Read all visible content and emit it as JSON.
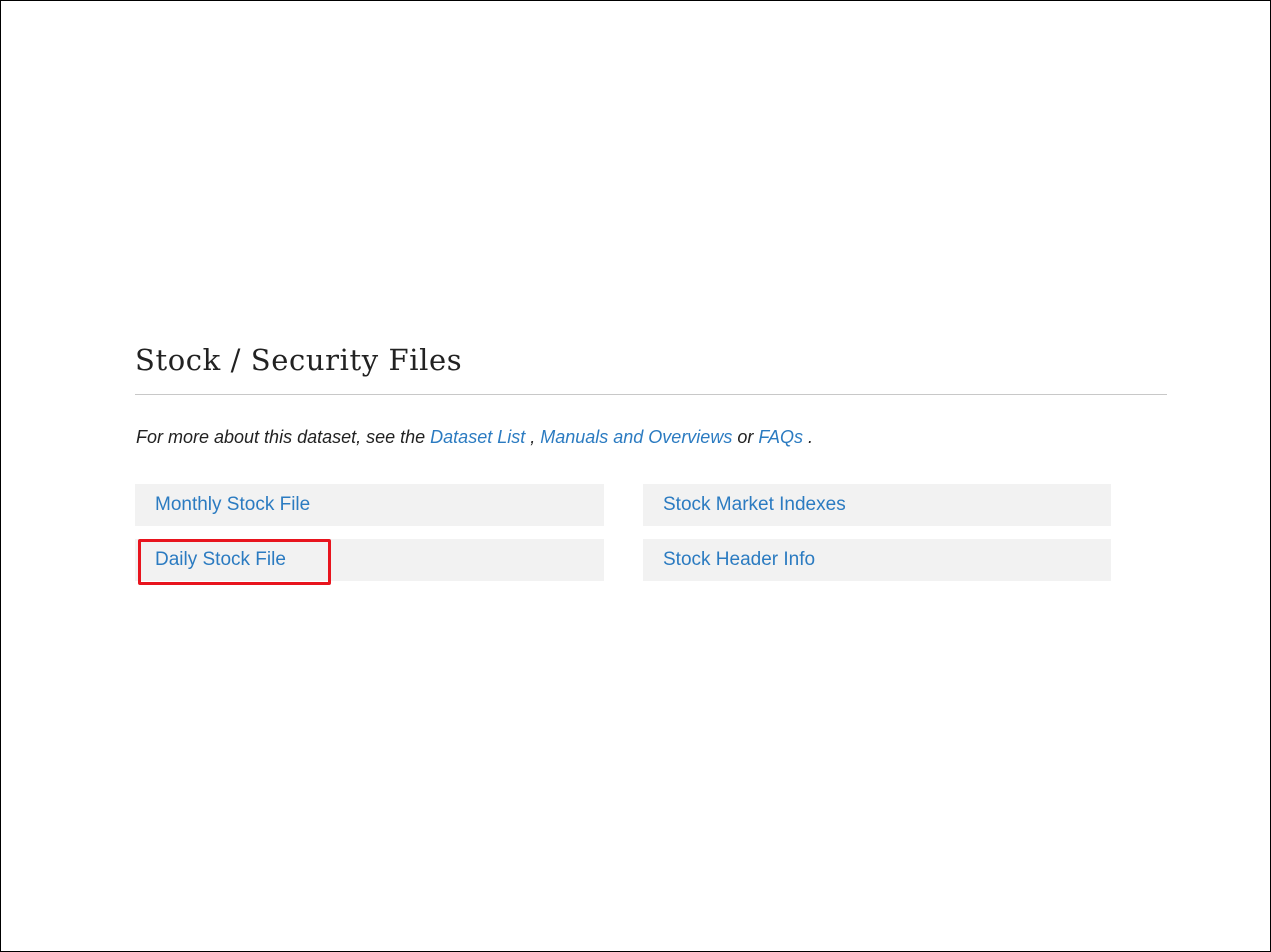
{
  "section": {
    "title": "Stock / Security Files"
  },
  "intro": {
    "prefix": "For more about this dataset, see the ",
    "link_dataset_list": "Dataset List",
    "sep1": " , ",
    "link_manuals": "Manuals and Overviews",
    "sep2": " or ",
    "link_faqs": "FAQs",
    "suffix": " ."
  },
  "tiles": [
    {
      "label": "Monthly Stock File"
    },
    {
      "label": "Daily Stock File"
    },
    {
      "label": "Stock Market Indexes"
    },
    {
      "label": "Stock Header Info"
    }
  ],
  "colors": {
    "link": "#2b7bc1",
    "tile_background": "#f2f2f2",
    "highlight": "#e8141e",
    "text": "#222222"
  }
}
